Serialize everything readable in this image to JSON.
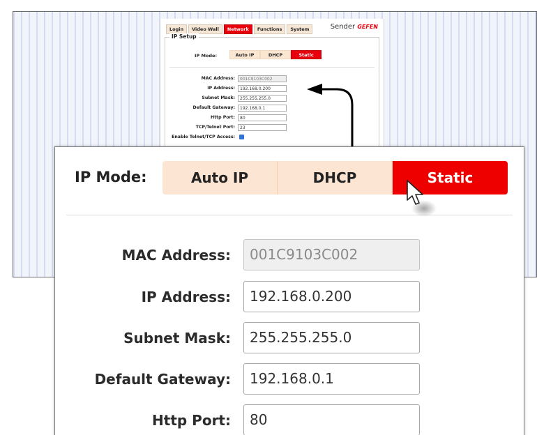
{
  "nav_tabs": [
    {
      "label": "Login"
    },
    {
      "label": "Video Wall"
    },
    {
      "label": "Network",
      "active": true
    },
    {
      "label": "Functions"
    },
    {
      "label": "System"
    }
  ],
  "brand": {
    "sender": "Sender",
    "logo": "GEFEN"
  },
  "ip_setup": {
    "legend": "IP Setup"
  },
  "ip_mode": {
    "label": "IP Mode:",
    "options": [
      "Auto IP",
      "DHCP",
      "Static"
    ],
    "selected": "Static"
  },
  "fields": {
    "mac_label": "MAC Address:",
    "mac_value": "001C9103C002",
    "ip_label": "IP Address:",
    "ip_value": "192.168.0.200",
    "subnet_label": "Subnet Mask:",
    "subnet_value": "255.255.255.0",
    "gateway_label": "Default Gateway:",
    "gateway_value": "192.168.0.1",
    "http_label": "Http Port:",
    "http_value": "80",
    "telnet_label": "TCP/Telnet Port:",
    "telnet_value": "23",
    "telnet_access_label": "Enable Telnet/TCP Access:"
  },
  "colors": {
    "accent": "#e8000d",
    "tab_bg": "#fce6d3"
  }
}
